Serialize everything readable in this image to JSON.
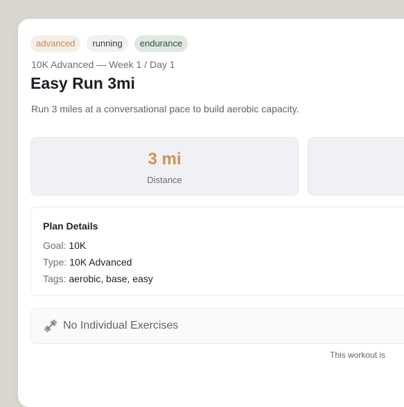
{
  "tags": [
    "advanced",
    "running",
    "endurance"
  ],
  "plan_subtitle": "10K Advanced — Week 1 / Day 1",
  "title": "Easy Run 3mi",
  "description": "Run 3 miles at a conversational pace to build aerobic capacity.",
  "stats": [
    {
      "value": "3 mi",
      "label": "Distance"
    }
  ],
  "plan_details": {
    "title": "Plan Details",
    "goal_label": "Goal:",
    "goal_value": "10K",
    "type_label": "Type:",
    "type_value": "10K Advanced",
    "tags_label": "Tags:",
    "tags_value": "aerobic, base, easy"
  },
  "exercises": {
    "icon": "dumbbell-icon",
    "empty_label": "No Individual Exercises"
  },
  "footer_note": "This workout is",
  "colors": {
    "accent": "#d1924f",
    "advanced_tag_text": "#c98a4c",
    "endurance_tag_bg": "#dfe9e1",
    "page_background": "#d9d6cf"
  }
}
